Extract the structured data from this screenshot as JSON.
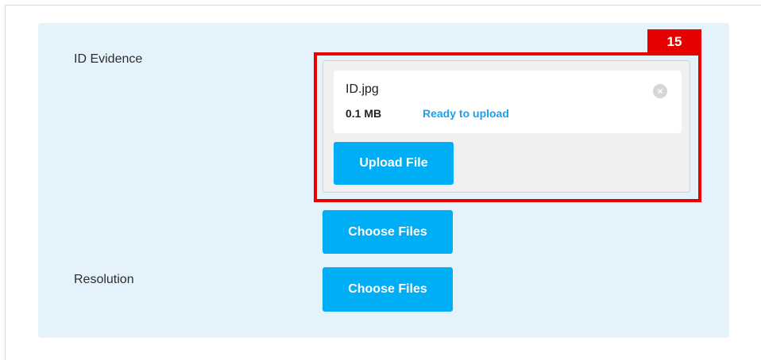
{
  "form": {
    "id_evidence_label": "ID Evidence",
    "resolution_label": "Resolution"
  },
  "upload": {
    "file_name": "ID.jpg",
    "file_size": "0.1 MB",
    "status": "Ready to upload",
    "upload_button": "Upload File",
    "remove_icon": "×"
  },
  "choose_files": {
    "id_evidence_button": "Choose Files",
    "resolution_button": "Choose Files"
  },
  "annotation": {
    "marker_number": "15"
  },
  "colors": {
    "panel_background": "#e3f2fb",
    "button": "#00aef5",
    "status_text": "#1ea0e8",
    "highlight": "#e60000"
  },
  "icons": {
    "remove": "close-circle-icon"
  }
}
